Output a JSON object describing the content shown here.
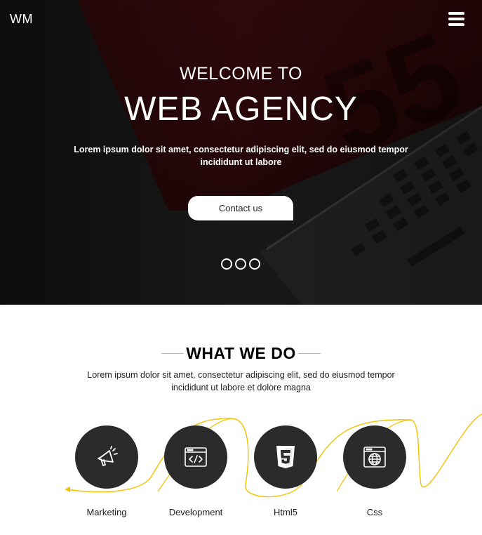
{
  "brand": {
    "logo_text": "WM"
  },
  "hero": {
    "subtitle": "WELCOME TO",
    "title": "WEB AGENCY",
    "text": "Lorem ipsum dolor sit amet, consectetur adipiscing elit, sed do eiusmod tempor incididunt ut labore",
    "contact_label": "Contact us",
    "background_number": "55",
    "slides": 3
  },
  "services_section": {
    "title": "WHAT WE DO",
    "text": "Lorem ipsum dolor sit amet, consectetur adipiscing elit, sed do eiusmod tempor incididunt ut labore et dolore magna",
    "items": [
      {
        "label": "Marketing",
        "icon": "megaphone-icon"
      },
      {
        "label": "Development",
        "icon": "code-window-icon"
      },
      {
        "label": "Html5",
        "icon": "html5-icon"
      },
      {
        "label": "Css",
        "icon": "globe-window-icon"
      }
    ]
  },
  "colors": {
    "accent": "#f2c200",
    "hero_bg": "#1a1a1a",
    "circle": "#2b2b2b"
  }
}
